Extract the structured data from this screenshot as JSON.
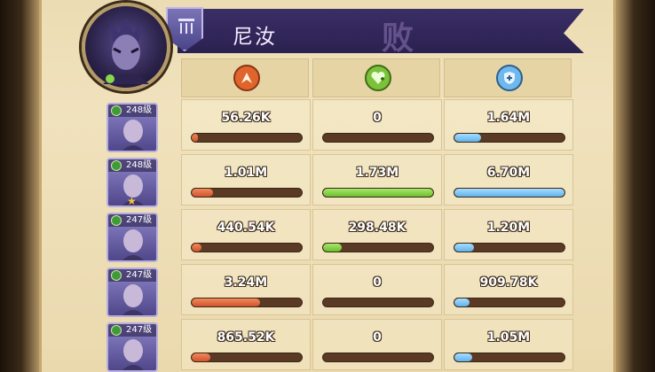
{
  "header": {
    "name": "尼汝",
    "result_stamp": "败"
  },
  "columns": [
    {
      "icon": "damage-icon",
      "color": "#e0652d"
    },
    {
      "icon": "heal-icon",
      "color": "#7cc13a"
    },
    {
      "icon": "shield-icon",
      "color": "#6fb8ee"
    }
  ],
  "heroes": [
    {
      "level": "248级",
      "star": false,
      "damage": "56.26K",
      "heal": "0",
      "taken": "1.64M",
      "damage_frac": 0.017,
      "heal_frac": 0.0,
      "taken_frac": 0.24
    },
    {
      "level": "248级",
      "star": true,
      "damage": "1.01M",
      "heal": "1.73M",
      "taken": "6.70M",
      "damage_frac": 0.19,
      "heal_frac": 1.0,
      "taken_frac": 1.0
    },
    {
      "level": "247级",
      "star": false,
      "damage": "440.54K",
      "heal": "298.48K",
      "taken": "1.20M",
      "damage_frac": 0.09,
      "heal_frac": 0.17,
      "taken_frac": 0.18
    },
    {
      "level": "247级",
      "star": false,
      "damage": "3.24M",
      "heal": "0",
      "taken": "909.78K",
      "damage_frac": 0.62,
      "heal_frac": 0.0,
      "taken_frac": 0.14
    },
    {
      "level": "247级",
      "star": false,
      "damage": "865.52K",
      "heal": "0",
      "taken": "1.05M",
      "damage_frac": 0.17,
      "heal_frac": 0.0,
      "taken_frac": 0.16
    }
  ],
  "star_glyph": "★"
}
